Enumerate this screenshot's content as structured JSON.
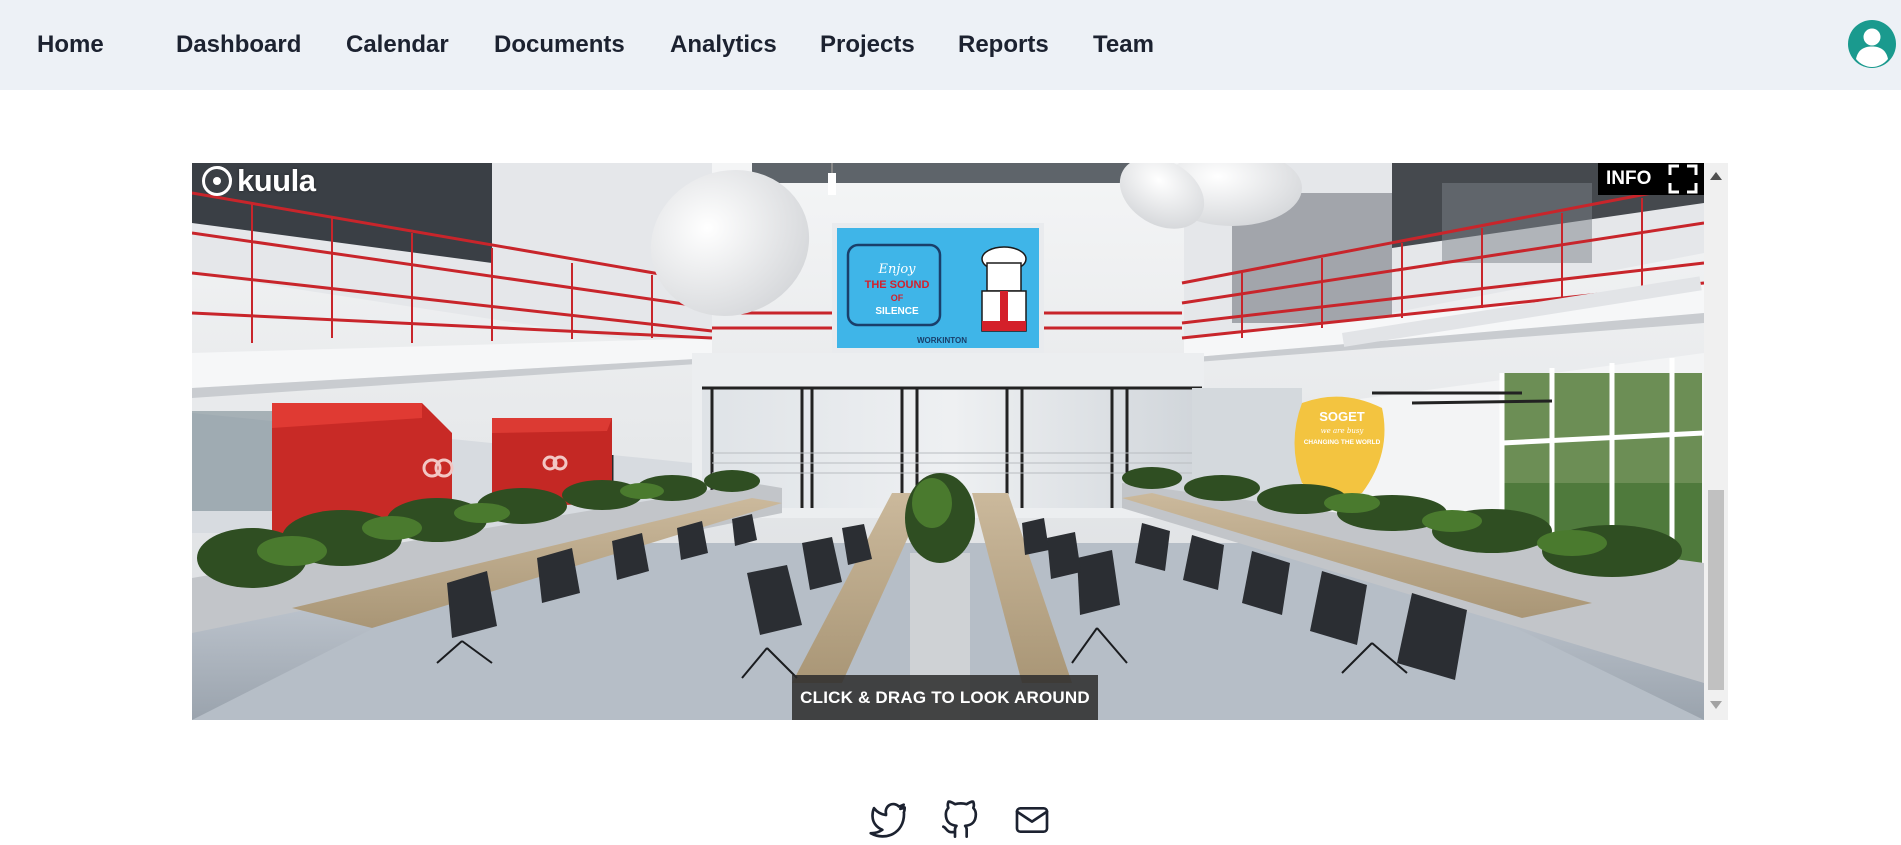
{
  "nav": {
    "items": [
      {
        "label": "Home"
      },
      {
        "label": "Dashboard"
      },
      {
        "label": "Calendar"
      },
      {
        "label": "Documents"
      },
      {
        "label": "Analytics"
      },
      {
        "label": "Projects"
      },
      {
        "label": "Reports"
      },
      {
        "label": "Team"
      }
    ],
    "avatar_icon": "user-avatar-icon"
  },
  "viewer": {
    "brand": "kuula",
    "info_label": "INFO",
    "hint": "CLICK & DRAG TO LOOK AROUND",
    "screen": {
      "line1": "Enjoy",
      "line2": "THE SOUND",
      "line3": "OF",
      "line4": "SILENCE",
      "brand": "WORKINTON"
    },
    "poster": {
      "line1": "SOGET",
      "line2": "we are busy",
      "line3": "CHANGING THE WORLD"
    }
  },
  "footer": {
    "icons": [
      "twitter-icon",
      "github-icon",
      "mail-icon"
    ]
  },
  "colors": {
    "nav_bg": "#edf1f6",
    "accent": "#1a9a8e",
    "railing": "#c8252b",
    "screen_blue": "#3fb5e8"
  }
}
